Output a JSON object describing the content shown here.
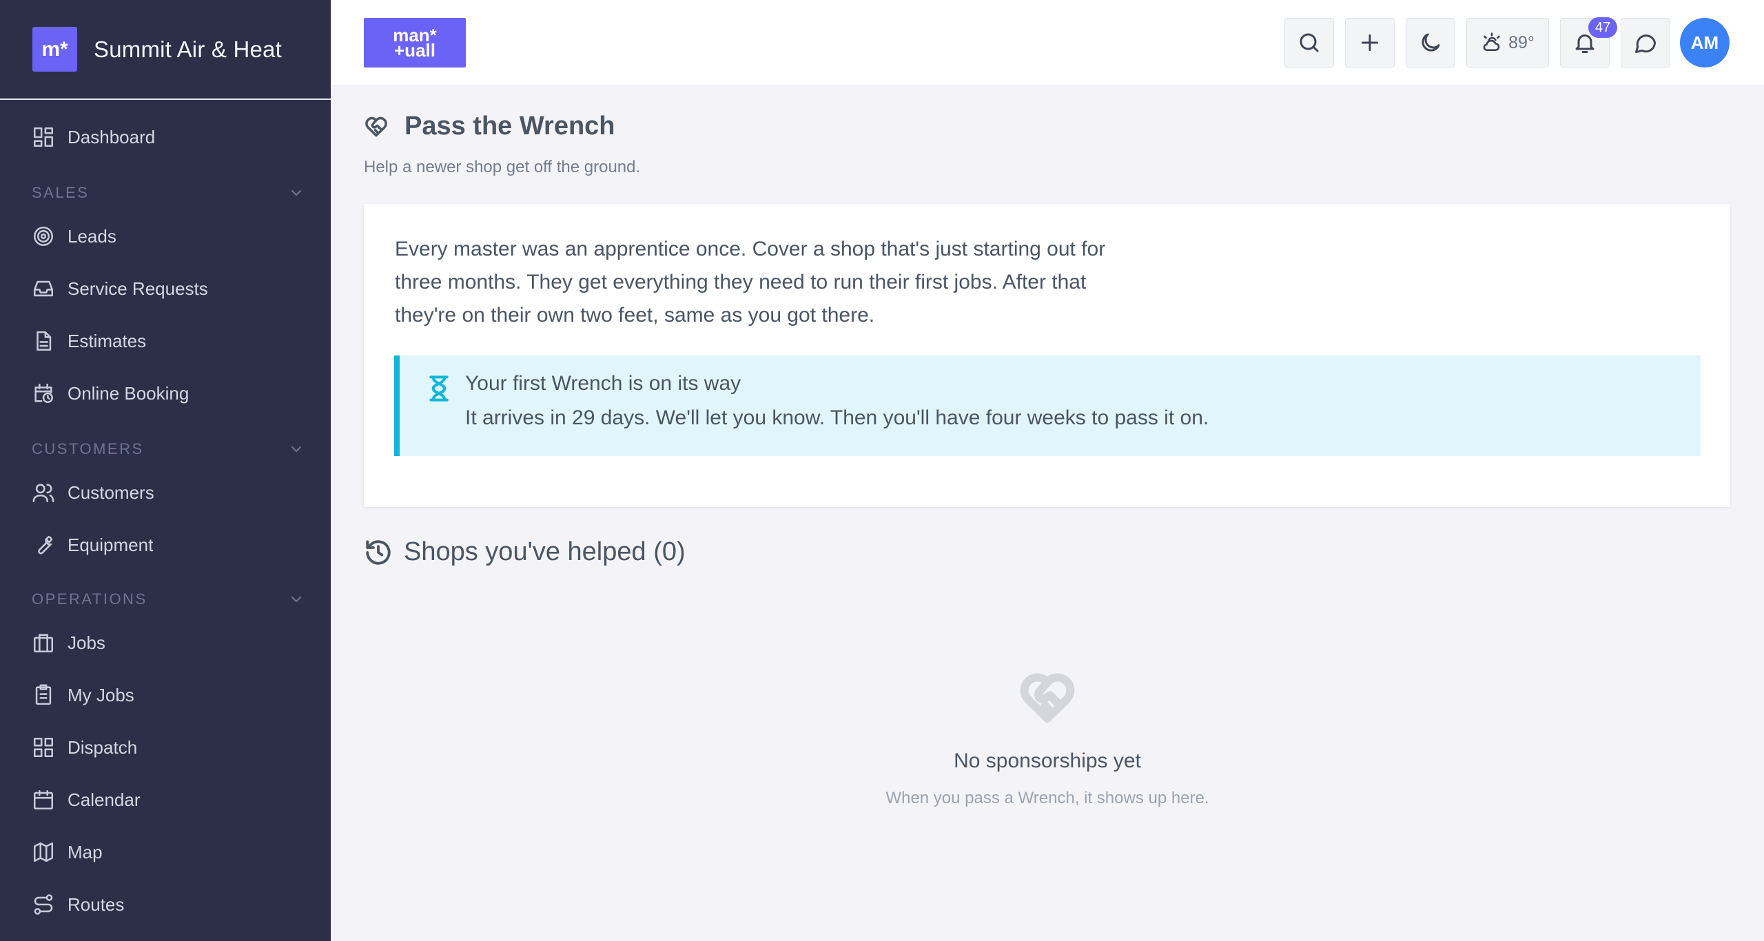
{
  "brand": {
    "logo_text": "m*",
    "name": "Summit Air & Heat"
  },
  "topbar": {
    "logo_line1": "man*",
    "logo_line2": "+uall",
    "weather_temp": "89°",
    "notifications_count": "47",
    "avatar_initials": "AM"
  },
  "sidebar": {
    "dashboard": "Dashboard",
    "sections": {
      "sales": "SALES",
      "customers": "CUSTOMERS",
      "operations": "OPERATIONS"
    },
    "items": {
      "leads": "Leads",
      "service_requests": "Service Requests",
      "estimates": "Estimates",
      "online_booking": "Online Booking",
      "customers": "Customers",
      "equipment": "Equipment",
      "jobs": "Jobs",
      "my_jobs": "My Jobs",
      "dispatch": "Dispatch",
      "calendar": "Calendar",
      "map": "Map",
      "routes": "Routes"
    }
  },
  "page": {
    "title": "Pass the Wrench",
    "subtitle": "Help a newer shop get off the ground.",
    "intro": "Every master was an apprentice once. Cover a shop that's just starting out for three months. They get everything they need to run their first jobs. After that they're on their own two feet, same as you got there.",
    "alert_title": "Your first Wrench is on its way",
    "alert_text": "It arrives in 29 days. We'll let you know. Then you'll have four weeks to pass it on.",
    "helped_title": "Shops you've helped (0)",
    "empty_title": "No sponsorships yet",
    "empty_sub": "When you pass a Wrench, it shows up here."
  },
  "colors": {
    "sidebar_bg": "#2c2f47",
    "accent": "#6b63f5",
    "alert_border": "#12b6d8",
    "alert_bg": "#e0f6fb",
    "avatar_bg": "#3b82f6"
  }
}
